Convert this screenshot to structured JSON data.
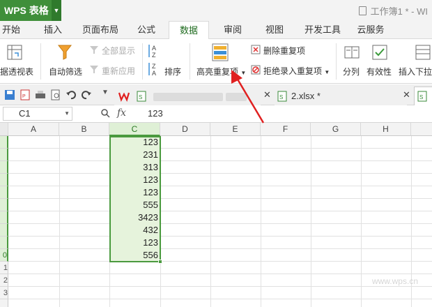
{
  "app": {
    "name": "WPS 表格",
    "window_title": "工作簿1 * - WI"
  },
  "ribbon_tabs": [
    {
      "label": "开始"
    },
    {
      "label": "插入"
    },
    {
      "label": "页面布局"
    },
    {
      "label": "公式"
    },
    {
      "label": "数据",
      "active": true
    },
    {
      "label": "审阅"
    },
    {
      "label": "视图"
    },
    {
      "label": "开发工具"
    },
    {
      "label": "云服务"
    }
  ],
  "ribbon": {
    "pivot": "据透视表",
    "autofilter": "自动筛选",
    "show_all": "全部显示",
    "reapply": "重新应用",
    "sort": "排序",
    "highlight_dup": "高亮重复项",
    "remove_dup": "删除重复项",
    "reject_dup": "拒绝录入重复项",
    "split": "分列",
    "validity": "有效性",
    "insert_dropdown": "插入下拉"
  },
  "doc_tabs": [
    {
      "label": "2.xlsx *"
    }
  ],
  "formula_bar": {
    "name_box": "C1",
    "fx": "fx",
    "value": "123"
  },
  "columns": [
    "A",
    "B",
    "C",
    "D",
    "E",
    "F",
    "G",
    "H"
  ],
  "row_numbers": [
    "",
    "",
    "",
    "",
    "",
    "",
    "",
    "",
    "",
    "0",
    "1",
    "2",
    "3",
    ""
  ],
  "column_c_values": [
    "123",
    "231",
    "313",
    "123",
    "123",
    "555",
    "3423",
    "432",
    "123",
    "556"
  ],
  "watermark": "www.wps.cn",
  "colors": {
    "wps_green": "#3f8f3a",
    "selection_fill": "#e6f3dc",
    "selection_border": "#4a9a3e",
    "arrow": "#e02020"
  }
}
